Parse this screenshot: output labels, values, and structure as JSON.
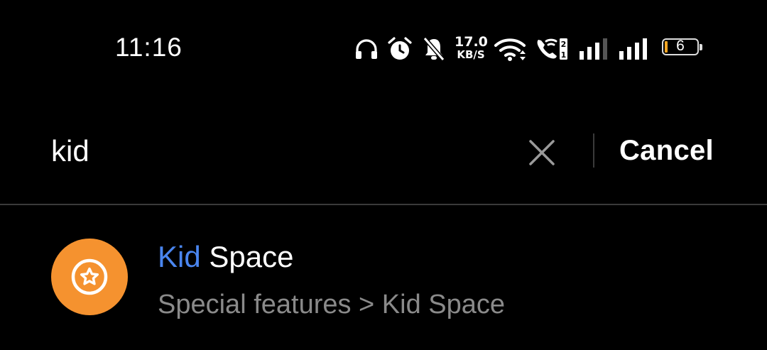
{
  "status_bar": {
    "time": "11:16",
    "net_speed_value": "17.0",
    "net_speed_unit": "KB/S",
    "sim_slot_top": "2",
    "sim_slot_bottom": "1",
    "battery_level": "6",
    "battery_fill_percent": 6,
    "battery_color": "#f5a623",
    "icons": [
      "headphones-icon",
      "alarm-icon",
      "notifications-muted-icon",
      "wifi-icon",
      "wifi-calling-icon",
      "signal-icon",
      "signal-icon",
      "battery-icon"
    ]
  },
  "search": {
    "query": "kid",
    "clear_icon": "close-icon",
    "cancel_label": "Cancel"
  },
  "results": [
    {
      "icon": "star-circle-icon",
      "icon_color": "#f5922f",
      "title_match": "Kid",
      "title_rest": " Space",
      "match_color": "#4a86f0",
      "path": "Special features > Kid Space"
    }
  ]
}
